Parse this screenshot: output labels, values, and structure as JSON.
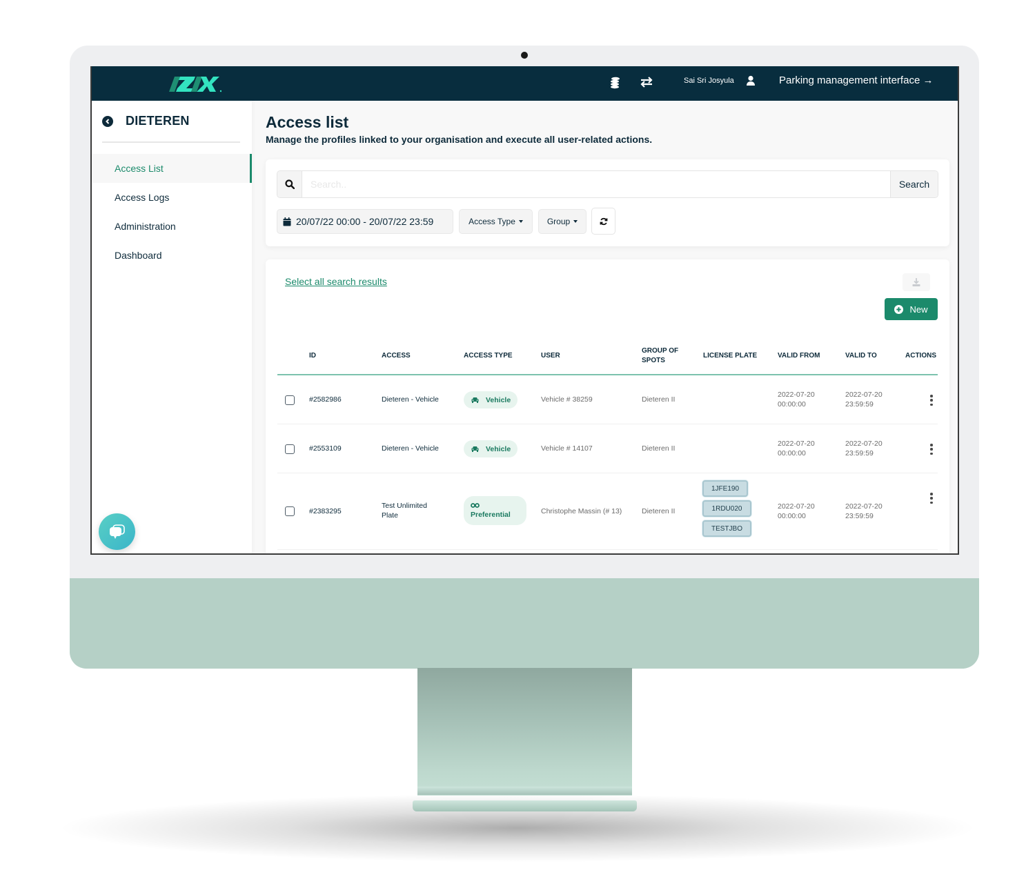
{
  "topbar": {
    "logo_text": "/Z/X.",
    "icons": [
      "coins-icon",
      "transfer-arrows-icon"
    ],
    "user_name": "Sai Sri Josyula",
    "user_icon": "user-icon",
    "interface_link": "Parking management interface →"
  },
  "sidebar": {
    "org_name": "DIETEREN",
    "back_icon": "chevron-left-circle-icon",
    "items": [
      {
        "label": "Access List",
        "active": true
      },
      {
        "label": "Access Logs",
        "active": false
      },
      {
        "label": "Administration",
        "active": false
      },
      {
        "label": "Dashboard",
        "active": false
      }
    ],
    "chat_icon": "chat-bubble-icon"
  },
  "main": {
    "title": "Access list",
    "subtitle": "Manage the profiles linked to your organisation and execute all user-related actions."
  },
  "filters": {
    "search_placeholder": "Search..",
    "search_value": "",
    "search_button": "Search",
    "date_range": "20/07/22 00:00 - 20/07/22 23:59",
    "access_type_label": "Access Type",
    "group_label": "Group"
  },
  "table": {
    "select_all_label": "Select all search results",
    "new_button_label": "New",
    "accent_color": "#1b8a6b",
    "columns": [
      "ID",
      "ACCESS",
      "ACCESS TYPE",
      "USER",
      "GROUP OF SPOTS",
      "LICENSE PLATE",
      "VALID FROM",
      "VALID TO",
      "ACTIONS"
    ],
    "rows": [
      {
        "id": "#2582986",
        "access": "Dieteren - Vehicle",
        "access_type": "Vehicle",
        "access_type_icon": "car-icon",
        "user": "Vehicle # 38259",
        "group": "Dieteren II",
        "plates": [],
        "valid_from_date": "2022-07-20",
        "valid_from_time": "00:00:00",
        "valid_to_date": "2022-07-20",
        "valid_to_time": "23:59:59"
      },
      {
        "id": "#2553109",
        "access": "Dieteren - Vehicle",
        "access_type": "Vehicle",
        "access_type_icon": "car-icon",
        "user": "Vehicle # 14107",
        "group": "Dieteren II",
        "plates": [],
        "valid_from_date": "2022-07-20",
        "valid_from_time": "00:00:00",
        "valid_to_date": "2022-07-20",
        "valid_to_time": "23:59:59"
      },
      {
        "id": "#2383295",
        "access_line1": "Test Unlimited",
        "access_line2": "Plate",
        "access_type": "Preferential",
        "access_type_icon": "infinity-icon",
        "user": "Christophe Massin (# 13)",
        "group": "Dieteren II",
        "plates": [
          "1JFE190",
          "1RDU020",
          "TESTJBO"
        ],
        "valid_from_date": "2022-07-20",
        "valid_from_time": "00:00:00",
        "valid_to_date": "2022-07-20",
        "valid_to_time": "23:59:59"
      }
    ]
  }
}
